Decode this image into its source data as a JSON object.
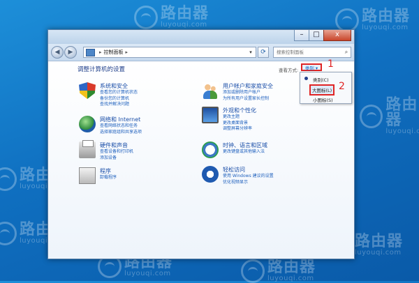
{
  "watermark": {
    "brand": "路由器",
    "url": "luyouqi.com"
  },
  "window": {
    "buttons": {
      "minimize": "–",
      "maximize": "□",
      "close": "x"
    },
    "nav": {
      "back": "◀",
      "forward": "▶"
    },
    "address": {
      "sep": "▸",
      "path": "控制面板",
      "tail": "▸"
    },
    "search": {
      "placeholder": "搜索控制面板"
    }
  },
  "content": {
    "title": "调整计算机的设置",
    "view_by_label": "查看方式:",
    "view_by_value": "类别 ▾",
    "callouts": [
      "1",
      "2"
    ],
    "view_menu": [
      {
        "label": "类别(C)",
        "checked": true
      },
      {
        "label": "大图标(L)",
        "highlighted": true
      },
      {
        "label": "小图标(S)"
      }
    ],
    "categories": [
      {
        "title": "系统和安全",
        "links": [
          "查看您的计算机状态",
          "备份您的计算机",
          "查找并解决问题"
        ],
        "icon": "shield-icon"
      },
      {
        "title": "网络和 Internet",
        "links": [
          "查看网络状态和任务",
          "选择家庭组和共享选项"
        ],
        "icon": "globe-icon"
      },
      {
        "title": "硬件和声音",
        "links": [
          "查看设备和打印机",
          "添加设备"
        ],
        "icon": "printer-icon"
      },
      {
        "title": "程序",
        "links": [
          "卸载程序"
        ],
        "icon": "programs-icon"
      },
      {
        "title": "用户帐户和家庭安全",
        "links": [
          "添加或删除用户帐户",
          "为所有用户设置家长控制"
        ],
        "icon": "users-icon"
      },
      {
        "title": "外观和个性化",
        "links": [
          "更改主题",
          "更改桌面背景",
          "调整屏幕分辨率"
        ],
        "icon": "monitor-icon"
      },
      {
        "title": "时钟、语言和区域",
        "links": [
          "更改键盘或其他输入法"
        ],
        "icon": "clock-icon"
      },
      {
        "title": "轻松访问",
        "links": [
          "使用 Windows 建议的设置",
          "优化视频显示"
        ],
        "icon": "accessibility-icon"
      }
    ]
  }
}
